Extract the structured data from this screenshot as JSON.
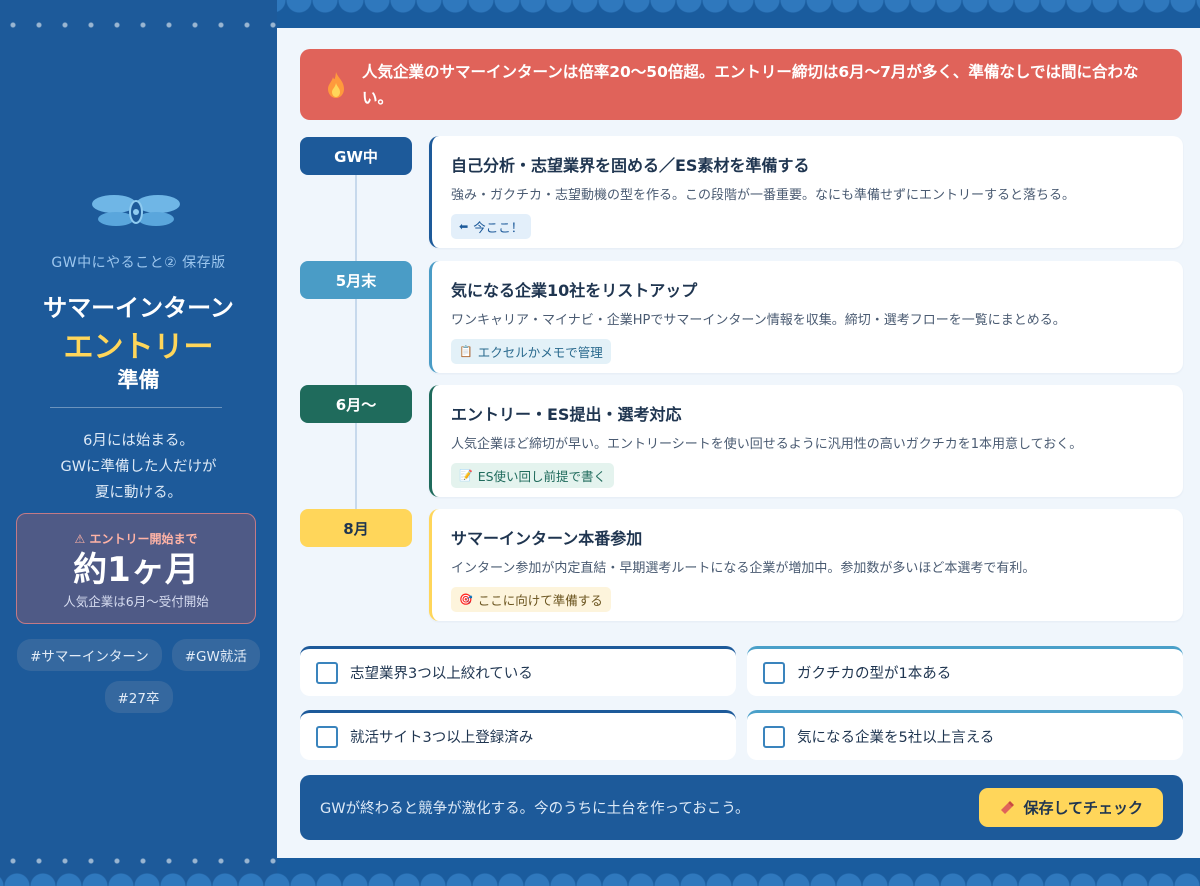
{
  "sidebar": {
    "subtitle": "GW中にやること② 保存版",
    "title_line1": "サマーインターン",
    "title_line2": "エントリー",
    "title_line3": "準備",
    "lead": [
      "6月には始まる。",
      "GWに準備した人だけが",
      "夏に動ける。"
    ],
    "countdown": {
      "label": "⚠ エントリー開始まで",
      "value": "約1ヶ月",
      "note": "人気企業は6月〜受付開始"
    },
    "tags": [
      "#サマーインターン",
      "#GW就活",
      "#27卒"
    ]
  },
  "alert": {
    "icon": "fire-icon",
    "text": "人気企業のサマーインターンは倍率20〜50倍超。エントリー締切は6月〜7月が多く、準備なしでは間に合わない。"
  },
  "timeline": [
    {
      "period": "GW中",
      "color": "#1d5a9a",
      "title": "自己分析・志望業界を固める／ES素材を準備する",
      "desc": "強み・ガクチカ・志望動機の型を作る。この段階が一番重要。なにも準備せずにエントリーすると落ちる。",
      "chip_icon": "⬅",
      "chip": "今ここ！",
      "chip_bg": "#e3effa",
      "chip_fg": "#1d5a9a"
    },
    {
      "period": "5月末",
      "color": "#4a9cc6",
      "title": "気になる企業10社をリストアップ",
      "desc": "ワンキャリア・マイナビ・企業HPでサマーインターン情報を収集。締切・選考フローを一覧にまとめる。",
      "chip_icon": "📋",
      "chip": "エクセルかメモで管理",
      "chip_bg": "#e3f1f8",
      "chip_fg": "#2a6a8e"
    },
    {
      "period": "6月〜",
      "color": "#1f6b5c",
      "title": "エントリー・ES提出・選考対応",
      "desc": "人気企業ほど締切が早い。エントリーシートを使い回せるように汎用性の高いガクチカを1本用意しておく。",
      "chip_icon": "📝",
      "chip": "ES使い回し前提で書く",
      "chip_bg": "#e4f3ee",
      "chip_fg": "#1f6b5c"
    },
    {
      "period": "8月",
      "color": "#ffd65a",
      "title": "サマーインターン本番参加",
      "desc": "インターン参加が内定直結・早期選考ルートになる企業が増加中。参加数が多いほど本選考で有利。",
      "chip_icon": "🎯",
      "chip": "ここに向けて準備する",
      "chip_bg": "#fdf4dc",
      "chip_fg": "#6b5520"
    }
  ],
  "checklist": [
    {
      "label": "志望業界3つ以上絞れている",
      "checked": false
    },
    {
      "label": "ガクチカの型が1本ある",
      "checked": false
    },
    {
      "label": "就活サイト3つ以上登録済み",
      "checked": false
    },
    {
      "label": "気になる企業を5社以上言える",
      "checked": false
    }
  ],
  "footer": {
    "message": "GWが終わると競争が激化する。今のうちに土台を作っておこう。",
    "button_icon": "bookmark-icon",
    "button_label": "保存してチェック"
  }
}
